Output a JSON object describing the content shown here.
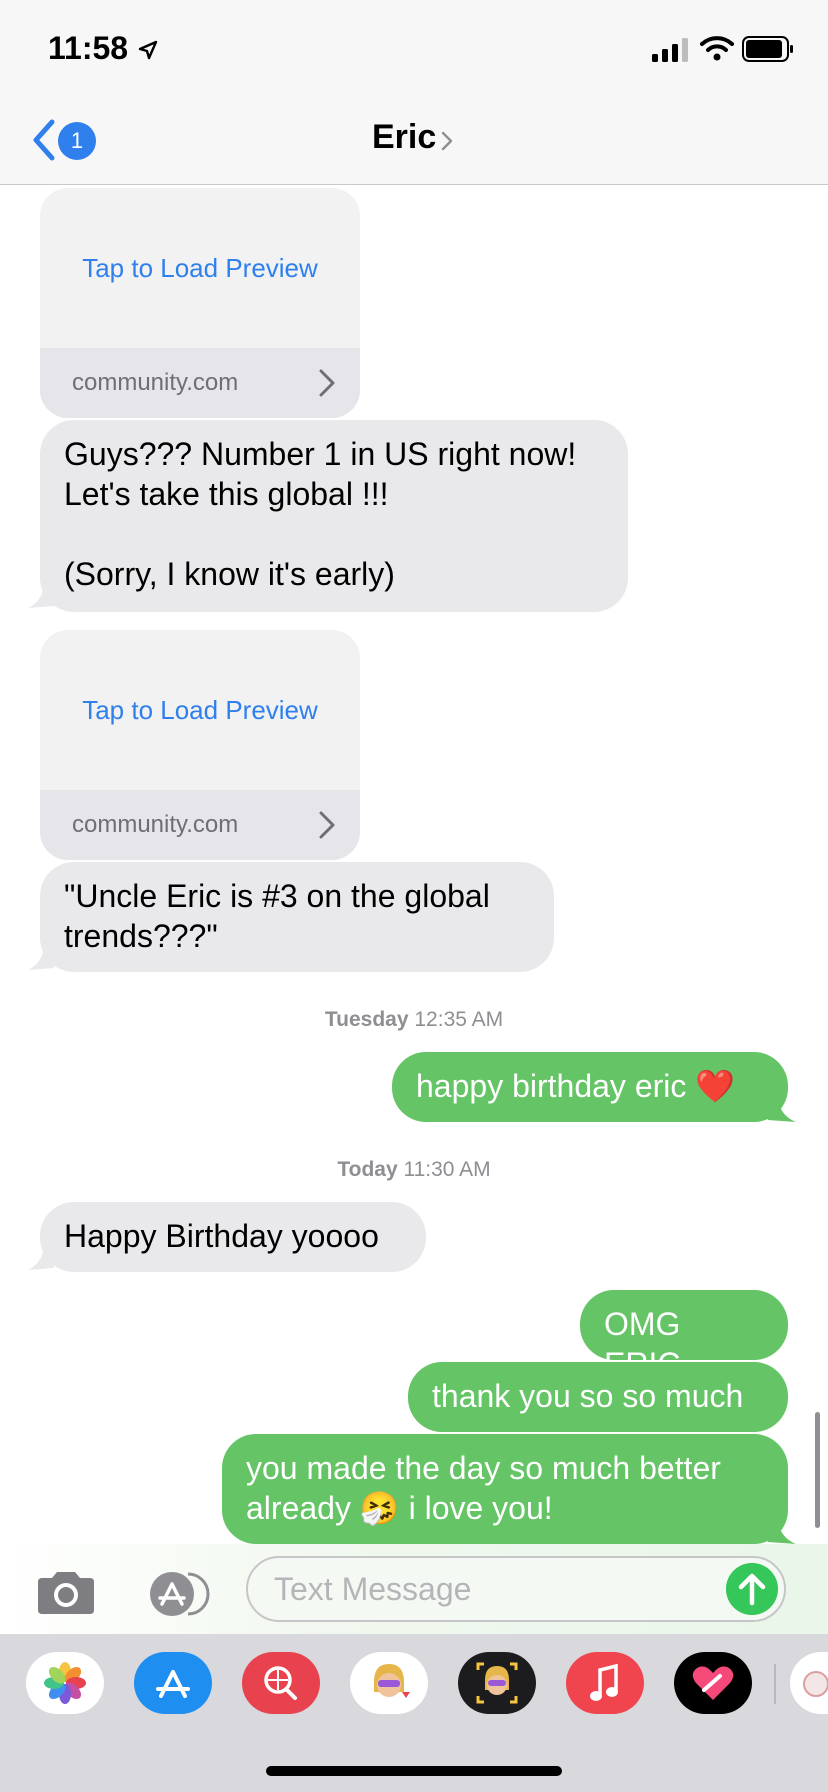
{
  "status": {
    "time": "11:58"
  },
  "nav": {
    "back_badge": "1",
    "contact_name": "Eric"
  },
  "links": [
    {
      "load_label": "Tap to Load Preview",
      "domain": "community.com"
    },
    {
      "load_label": "Tap to Load Preview",
      "domain": "community.com"
    }
  ],
  "messages": {
    "m1_line1": "Guys??? Number 1 in US right now!",
    "m1_line2": "Let's take this global !!!",
    "m1_line3": "(Sorry, I know it's early)",
    "m2_line1": "\"Uncle Eric is #3 on the global",
    "m2_line2": "trends???\"",
    "stamp1_day": "Tuesday",
    "stamp1_time": "12:35 AM",
    "m3": "happy birthday eric ❤️",
    "stamp2_day": "Today",
    "stamp2_time": "11:30 AM",
    "m4": "Happy Birthday yoooo",
    "m5": "OMG ERIC",
    "m6": "thank you so so much",
    "m7_line1": "you made the day so much better",
    "m7_line2": "already 🤧 i love you!"
  },
  "input": {
    "placeholder": "Text Message"
  },
  "apps": [
    {
      "name": "photos-app",
      "color": "#ffffff"
    },
    {
      "name": "app-store-app",
      "color": "#1f8ef1"
    },
    {
      "name": "images-search-app",
      "color": "#e8424f"
    },
    {
      "name": "memoji-app",
      "color": "#ffffff"
    },
    {
      "name": "animoji-app",
      "color": "#1c1c1e"
    },
    {
      "name": "music-app",
      "color": "#f0454f"
    },
    {
      "name": "digital-touch-app",
      "color": "#000000"
    },
    {
      "name": "sticker-app",
      "color": "#ffffff"
    }
  ],
  "colors": {
    "incoming": "#e9e9eb",
    "outgoing": "#65c466",
    "link_blue": "#2f80ed"
  }
}
